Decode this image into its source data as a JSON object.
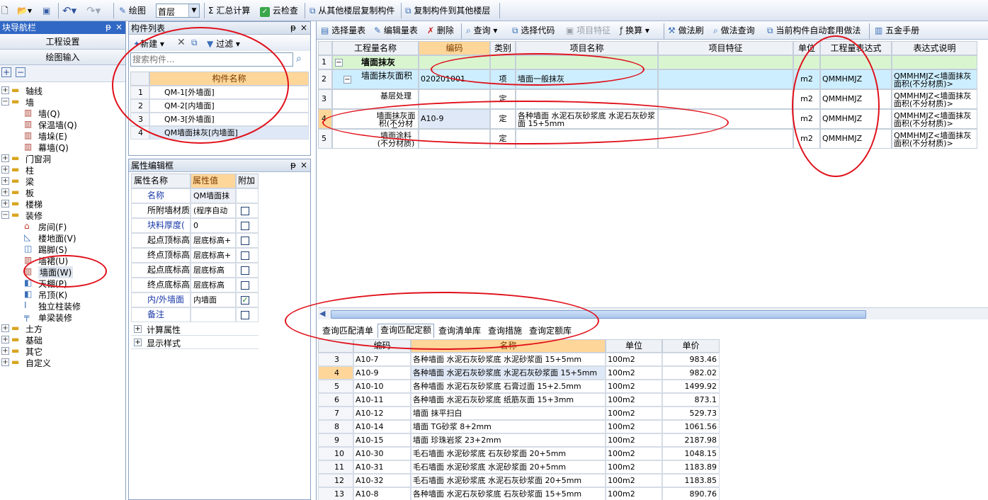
{
  "toolbar": {
    "draw_label": "绘图",
    "floor_value": "首层",
    "sum_label": "汇总计算",
    "cloud_check_label": "云检查",
    "copy_from_label": "从其他楼层复制构件",
    "copy_to_label": "复制构件到其他楼层"
  },
  "nav": {
    "title": "块导航栏",
    "pin": "ᵽ",
    "close": "×",
    "settings_label": "工程设置",
    "draw_input_label": "绘图输入",
    "tree": [
      {
        "label": "轴线",
        "level": 0,
        "expander": "+",
        "icon": "folder"
      },
      {
        "label": "墙",
        "level": 0,
        "expander": "−",
        "icon": "folder"
      },
      {
        "label": "墙(Q)",
        "level": 1,
        "icon": "wall"
      },
      {
        "label": "保温墙(Q)",
        "level": 1,
        "icon": "wall"
      },
      {
        "label": "墙垛(E)",
        "level": 1,
        "icon": "wall"
      },
      {
        "label": "幕墙(Q)",
        "level": 1,
        "icon": "wall"
      },
      {
        "label": "门窗洞",
        "level": 0,
        "expander": "+",
        "icon": "folder"
      },
      {
        "label": "柱",
        "level": 0,
        "expander": "+",
        "icon": "folder"
      },
      {
        "label": "梁",
        "level": 0,
        "expander": "+",
        "icon": "folder"
      },
      {
        "label": "板",
        "level": 0,
        "expander": "+",
        "icon": "folder"
      },
      {
        "label": "楼梯",
        "level": 0,
        "expander": "+",
        "icon": "folder"
      },
      {
        "label": "装修",
        "level": 0,
        "expander": "−",
        "icon": "folder"
      },
      {
        "label": "房间(F)",
        "level": 1,
        "icon": "house"
      },
      {
        "label": "楼地面(V)",
        "level": 1,
        "icon": "floor"
      },
      {
        "label": "踢脚(S)",
        "level": 1,
        "icon": "kick"
      },
      {
        "label": "墙裙(U)",
        "level": 1,
        "icon": "wall"
      },
      {
        "label": "墙面(W)",
        "level": 1,
        "icon": "wall",
        "selected": true
      },
      {
        "label": "天棚(P)",
        "level": 1,
        "icon": "ceiling"
      },
      {
        "label": "吊顶(K)",
        "level": 1,
        "icon": "ceiling"
      },
      {
        "label": "独立柱装修",
        "level": 1,
        "icon": "column"
      },
      {
        "label": "单梁装修",
        "level": 1,
        "icon": "beam"
      },
      {
        "label": "土方",
        "level": 0,
        "expander": "+",
        "icon": "folder"
      },
      {
        "label": "基础",
        "level": 0,
        "expander": "+",
        "icon": "folder"
      },
      {
        "label": "其它",
        "level": 0,
        "expander": "+",
        "icon": "folder"
      },
      {
        "label": "自定义",
        "level": 0,
        "expander": "+",
        "icon": "folder"
      }
    ]
  },
  "component_list": {
    "title": "构件列表",
    "new_label": "新建",
    "filter_label": "过滤",
    "search_placeholder": "搜索构件...",
    "column_header": "构件名称",
    "rows": [
      {
        "num": "1",
        "name": "QM-1[外墙面]"
      },
      {
        "num": "2",
        "name": "QM-2[内墙面]"
      },
      {
        "num": "3",
        "name": "QM-3[外墙面]"
      },
      {
        "num": "4",
        "name": "QM墙面抹灰[内墙面]",
        "selected": true
      }
    ]
  },
  "props": {
    "title": "属性编辑框",
    "headers": {
      "name": "属性名称",
      "value": "属性值",
      "extra": "附加"
    },
    "rows": [
      {
        "name": "名称",
        "value": "QM墙面抹",
        "blue": true,
        "check": null
      },
      {
        "name": "所附墙材质",
        "value": "(程序自动",
        "blue": false,
        "check": false
      },
      {
        "name": "块料厚度(",
        "value": "0",
        "blue": true,
        "check": false
      },
      {
        "name": "起点顶标高",
        "value": "层底标高+",
        "blue": false,
        "check": false
      },
      {
        "name": "终点顶标高",
        "value": "层底标高+",
        "blue": false,
        "check": false
      },
      {
        "name": "起点底标高",
        "value": "层底标高",
        "blue": false,
        "check": false
      },
      {
        "name": "终点底标高",
        "value": "层底标高",
        "blue": false,
        "check": false
      },
      {
        "name": "内/外墙面",
        "value": "内墙面",
        "blue": true,
        "check": true
      },
      {
        "name": "备注",
        "value": "",
        "blue": true,
        "check": false
      }
    ],
    "groups": [
      {
        "expander": "+",
        "label": "计算属性"
      },
      {
        "expander": "+",
        "label": "显示样式"
      }
    ]
  },
  "right_toolbar": {
    "select_list": "选择量表",
    "edit_list": "编辑量表",
    "delete": "删除",
    "query": "查询",
    "select_code": "选择代码",
    "item_feature": "项目特征",
    "convert": "换算",
    "brush": "做法刷",
    "method_query": "做法查询",
    "auto_apply": "当前构件自动套用做法",
    "manual": "五金手册"
  },
  "main_table": {
    "headers": [
      "工程量名称",
      "编码",
      "类别",
      "项目名称",
      "项目特征",
      "单位",
      "工程量表达式",
      "表达式说明"
    ],
    "rows": [
      {
        "num": "1",
        "expander": "−",
        "name": "墙面抹灰",
        "code": "",
        "cat": "",
        "item": "",
        "feature": "",
        "unit": "",
        "expr": "",
        "desc": "",
        "style": "group"
      },
      {
        "num": "2",
        "expander": "−",
        "name": "墙面抹灰面积",
        "code": "020201001",
        "cat": "项",
        "item": "墙面一般抹灰",
        "feature": "",
        "unit": "m2",
        "expr": "QMMHMJZ",
        "desc": "QMMHMJZ<墙面抹灰面积(不分材质)>",
        "style": "item"
      },
      {
        "num": "3",
        "name": "基层处理",
        "code": "",
        "cat": "定",
        "item": "",
        "feature": "",
        "unit": "m2",
        "expr": "QMMHMJZ",
        "desc": "QMMHMJZ<墙面抹灰面积(不分材质)>",
        "style": "quota"
      },
      {
        "num": "4",
        "name": "墙面抹灰面积(不分材质)",
        "code": "A10-9",
        "cat": "定",
        "item": "各种墙面 水泥石灰砂浆底 水泥石灰砂浆面 15+5mm",
        "feature": "",
        "unit": "m2",
        "expr": "QMMHMJZ",
        "desc": "QMMHMJZ<墙面抹灰面积(不分材质)>",
        "style": "quota-current"
      },
      {
        "num": "5",
        "name": "墙面涂料(不分材质)",
        "code": "",
        "cat": "定",
        "item": "",
        "feature": "",
        "unit": "m2",
        "expr": "QMMHMJZ",
        "desc": "QMMHMJZ<墙面抹灰面积(不分材质)>",
        "style": "quota"
      }
    ]
  },
  "lower_tabs": [
    "查询匹配清单",
    "查询匹配定额",
    "查询清单库",
    "查询措施",
    "查询定额库"
  ],
  "lower_table": {
    "headers": [
      "编码",
      "名称",
      "单位",
      "单价"
    ],
    "rows": [
      {
        "num": "3",
        "code": "A10-7",
        "name": "各种墙面 水泥石灰砂浆底 水泥砂浆面 15+5mm",
        "unit": "100m2",
        "price": "983.46"
      },
      {
        "num": "4",
        "code": "A10-9",
        "name": "各种墙面 水泥石灰砂浆底 水泥石灰砂浆面 15+5mm",
        "unit": "100m2",
        "price": "982.02",
        "selected": true
      },
      {
        "num": "5",
        "code": "A10-10",
        "name": "各种墙面 水泥石灰砂浆底 石膏过面 15+2.5mm",
        "unit": "100m2",
        "price": "1499.92"
      },
      {
        "num": "6",
        "code": "A10-11",
        "name": "各种墙面 水泥石灰砂浆底 纸筋灰面 15+3mm",
        "unit": "100m2",
        "price": "873.1"
      },
      {
        "num": "7",
        "code": "A10-12",
        "name": "墙面 抹平扫白",
        "unit": "100m2",
        "price": "529.73"
      },
      {
        "num": "8",
        "code": "A10-14",
        "name": "墙面 TG砂浆 8+2mm",
        "unit": "100m2",
        "price": "1061.56"
      },
      {
        "num": "9",
        "code": "A10-15",
        "name": "墙面 珍珠岩浆 23+2mm",
        "unit": "100m2",
        "price": "2187.98"
      },
      {
        "num": "10",
        "code": "A10-30",
        "name": "毛石墙面 水泥砂浆底 石灰砂浆面 20+5mm",
        "unit": "100m2",
        "price": "1048.15"
      },
      {
        "num": "11",
        "code": "A10-31",
        "name": "毛石墙面 水泥砂浆底 水泥砂浆面 20+5mm",
        "unit": "100m2",
        "price": "1183.89"
      },
      {
        "num": "12",
        "code": "A10-32",
        "name": "毛石墙面 水泥砂浆底 水泥石灰砂浆面 20+5mm",
        "unit": "100m2",
        "price": "1183.85"
      },
      {
        "num": "13",
        "code": "A10-8",
        "name": "各种墙面 水泥石灰砂浆底 石灰砂浆面 15+5mm",
        "unit": "100m2",
        "price": "890.76"
      }
    ]
  },
  "colors": {
    "annotation": "#e0101a",
    "header_orange": "#ffd699",
    "selection": "#dfe8f6",
    "row_blue": "#cdeeff"
  }
}
